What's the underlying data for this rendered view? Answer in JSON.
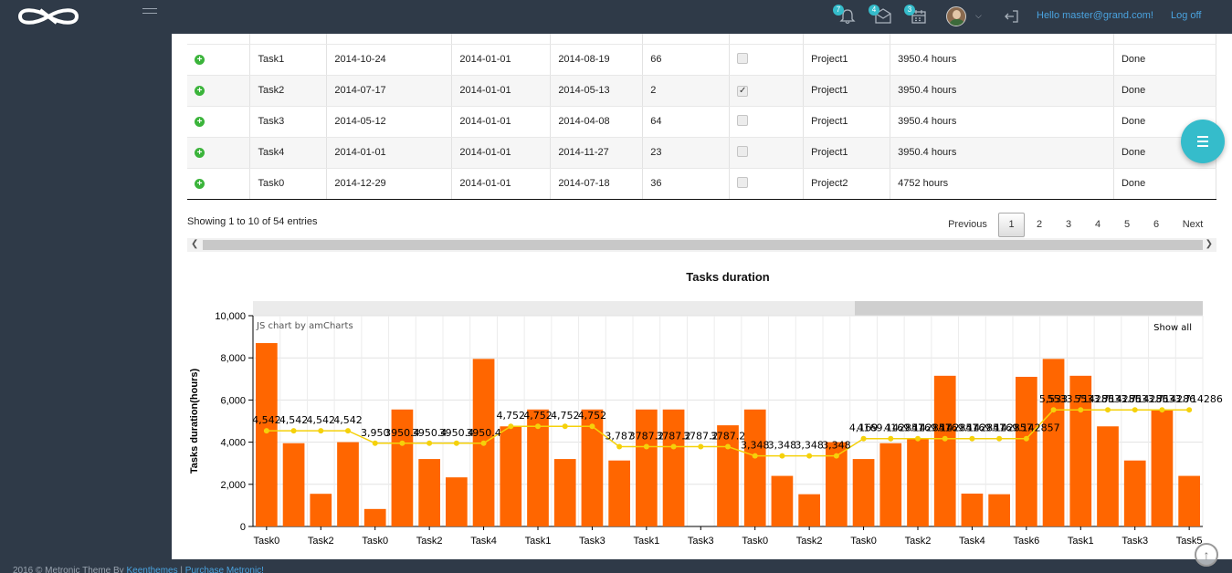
{
  "header": {
    "notifications_count": "7",
    "messages_count": "4",
    "calendar_count": "3",
    "hello_text": "Hello master@grand.com!",
    "logoff_label": "Log off"
  },
  "table": {
    "rows": [
      {
        "name": "Task1",
        "date1": "2014-10-24",
        "date2": "2014-01-01",
        "date3": "2014-08-19",
        "num": "66",
        "checked": false,
        "project": "Project1",
        "hours": "3950.4 hours",
        "status": "Done"
      },
      {
        "name": "Task2",
        "date1": "2014-07-17",
        "date2": "2014-01-01",
        "date3": "2014-05-13",
        "num": "2",
        "checked": true,
        "project": "Project1",
        "hours": "3950.4 hours",
        "status": "Done"
      },
      {
        "name": "Task3",
        "date1": "2014-05-12",
        "date2": "2014-01-01",
        "date3": "2014-04-08",
        "num": "64",
        "checked": false,
        "project": "Project1",
        "hours": "3950.4 hours",
        "status": "Done"
      },
      {
        "name": "Task4",
        "date1": "2014-01-01",
        "date2": "2014-01-01",
        "date3": "2014-11-27",
        "num": "23",
        "checked": false,
        "project": "Project1",
        "hours": "3950.4 hours",
        "status": "Done"
      },
      {
        "name": "Task0",
        "date1": "2014-12-29",
        "date2": "2014-01-01",
        "date3": "2014-07-18",
        "num": "36",
        "checked": false,
        "project": "Project2",
        "hours": "4752 hours",
        "status": "Done"
      }
    ],
    "info": "Showing 1 to 10 of 54 entries",
    "pager": {
      "previous": "Previous",
      "pages": [
        "1",
        "2",
        "3",
        "4",
        "5",
        "6"
      ],
      "next": "Next",
      "active": "1"
    }
  },
  "chart_data": {
    "type": "bar",
    "title": "Tasks duration",
    "ylabel": "Tasks duration(hours)",
    "credit": "JS chart by amCharts",
    "show_all": "Show all",
    "ylim": [
      0,
      10000
    ],
    "yticks": [
      "0",
      "2,000",
      "4,000",
      "6,000",
      "8,000",
      "10,000"
    ],
    "xlabels": [
      "Task0",
      "Task2",
      "Task0",
      "Task2",
      "Task4",
      "Task1",
      "Task3",
      "Task1",
      "Task3",
      "Task0",
      "Task2",
      "Task0",
      "Task2",
      "Task4",
      "Task6",
      "Task1",
      "Task3",
      "Task5"
    ],
    "bar_color": "#ff6600",
    "line_color": "#f5d10a",
    "series": [
      {
        "values": [
          8700,
          3950,
          1550,
          4000,
          830,
          5550,
          3200,
          2330,
          7950,
          4750,
          5550,
          3200,
          5550,
          3130,
          5550,
          5550,
          0,
          4800,
          5550,
          2400,
          1530,
          4000,
          3200,
          3950,
          4150,
          7150,
          1560,
          1530,
          7100,
          7950,
          7150,
          4750,
          3130,
          5550,
          2400
        ]
      },
      {
        "values": [
          4542,
          4542,
          4542,
          4542,
          3950,
          3950,
          3950,
          3950,
          3950,
          4752,
          4752,
          4752,
          4752,
          3787,
          3787,
          3787,
          3787,
          3787,
          3348,
          3348,
          3348,
          3348,
          4169,
          4169,
          4169,
          4169,
          4169,
          4169,
          4169,
          5533,
          5533,
          5533,
          5533,
          5533,
          5533
        ]
      }
    ],
    "line_labels": [
      "4,542",
      "4,542",
      "4,542",
      "4,542",
      "3,950",
      "3950.4",
      "3950.4",
      "3950.4",
      "3950.4",
      "4,752",
      "4,752",
      "4,752",
      "4,752",
      "3,787",
      "3787.2",
      "3787.2",
      "3787.2",
      "3787.2",
      "3,348",
      "3,348",
      "3,348",
      "3,348",
      "4,169",
      "4169.142857",
      "4169.142857",
      "4169.142857",
      "4169.142857",
      "4169.142857",
      "4169.142857",
      "5,533",
      "5533.714286",
      "5533.714286",
      "5533.714286",
      "5533.714286",
      "5533.714286"
    ],
    "grid": true
  },
  "footer": {
    "copyright": "2016 © Metronic Theme By",
    "author_link": "Keenthemes",
    "separator": "|",
    "purchase_link": "Purchase Metronic!"
  }
}
